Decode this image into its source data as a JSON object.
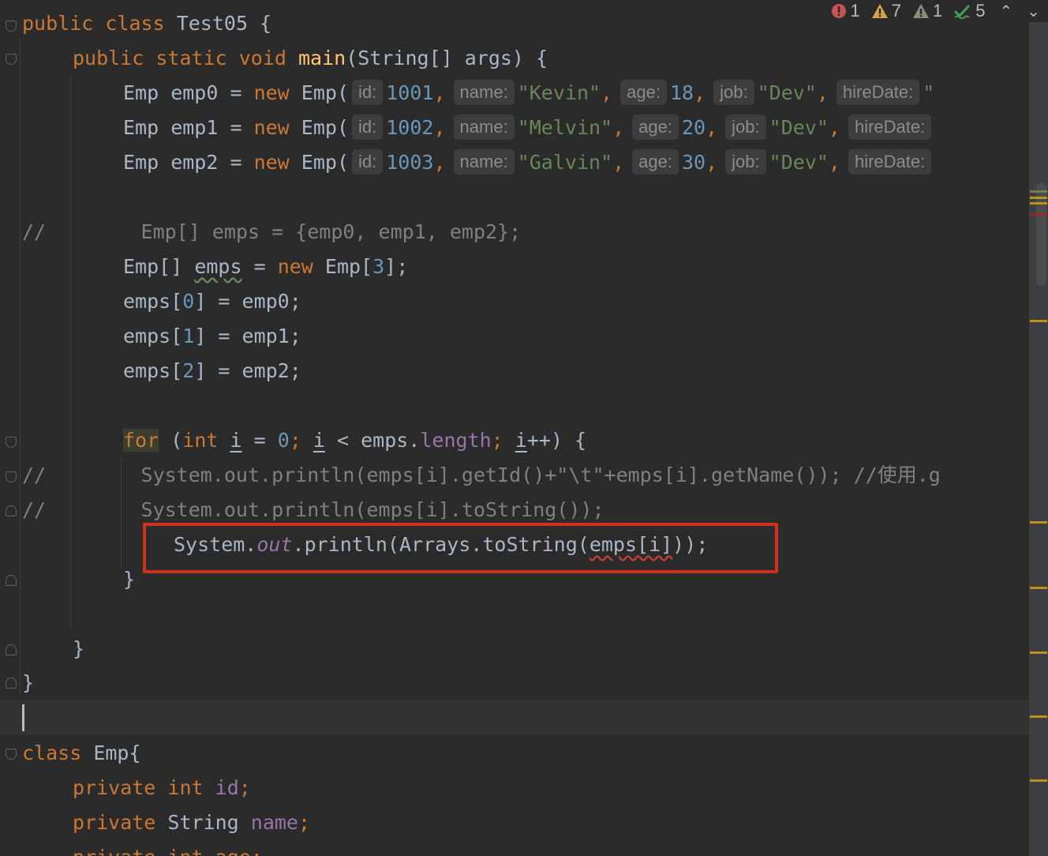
{
  "inspection": {
    "errors": "1",
    "warnings": "7",
    "weak_warnings": "1",
    "typos": "5"
  },
  "hints": {
    "id": "id:",
    "name": "name:",
    "age": "age:",
    "job": "job:",
    "hireDate": "hireDate:"
  },
  "code": {
    "l1_public": "public",
    "l1_class": "class",
    "l1_name": " Test05 {",
    "l2_mods": "public static void",
    "l2_main": "main",
    "l2_rest": "(String[] args) {",
    "emp_decl": [
      {
        "var": "Emp emp0 = ",
        "id": "1001",
        "name": "\"Kevin\"",
        "age": "18",
        "job": "\"Dev\"",
        "tail": "\""
      },
      {
        "var": "Emp emp1 = ",
        "id": "1002",
        "name": "\"Melvin\"",
        "age": "20",
        "job": "\"Dev\"",
        "tail": ""
      },
      {
        "var": "Emp emp2 = ",
        "id": "1003",
        "name": "\"Galvin\"",
        "age": "30",
        "job": "\"Dev\"",
        "tail": ""
      }
    ],
    "kw_new": "new",
    "emp_ctor": " Emp(",
    "comma": ",",
    "comment_emps": "//        Emp[] emps = {emp0, emp1, emp2};",
    "arr_decl_a": "Emp[] ",
    "arr_decl_emps": "emps",
    "arr_decl_b": " = ",
    "arr_decl_c": " Emp[",
    "arr_decl_num": "3",
    "arr_decl_d": "];",
    "assign": [
      {
        "a": "emps[",
        "n": "0",
        "b": "] = emp0;"
      },
      {
        "a": "emps[",
        "n": "1",
        "b": "] = emp1;"
      },
      {
        "a": "emps[",
        "n": "2",
        "b": "] = emp2;"
      }
    ],
    "for_kw": "for",
    "for_a": " (",
    "for_int": "int",
    "for_i": "i",
    "for_eq": " = ",
    "for_zero": "0",
    "for_semi": "; ",
    "for_lt": " < emps.",
    "for_length": "length",
    "for_end": "++) {",
    "cmt1": "//        System.out.println(emps[i].getId()+\"\\t\"+emps[i].getName()); //使用.g",
    "cmt2": "//        System.out.println(emps[i].toString());",
    "print_sys": "System.",
    "print_out": "out",
    "print_mid": ".println(Arrays.toString(",
    "print_arg": "emps[i]",
    "print_end": "));",
    "close_brace": "}",
    "class_kw": "class",
    "class_name": " Emp{",
    "f1_mod": "private int",
    "f1_name": "id",
    "f2_mod": "private",
    "f2_type": " String ",
    "f2_name": "name",
    "f3": "private int age;"
  }
}
